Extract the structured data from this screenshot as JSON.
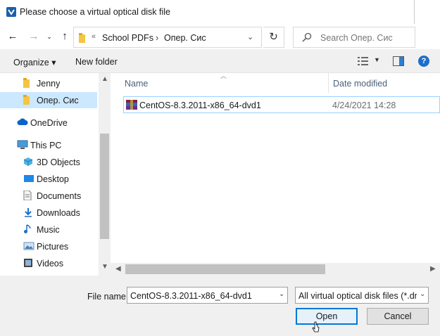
{
  "window": {
    "title": "Please choose a virtual optical disk file"
  },
  "nav": {
    "back_icon": "arrow-left-icon",
    "forward_icon": "arrow-right-icon",
    "recent_icon": "chevron-down-icon",
    "up_icon": "arrow-up-icon"
  },
  "address": {
    "overflow": "«",
    "crumbs": [
      "School PDFs",
      "Опер. Сис"
    ],
    "separator": "›"
  },
  "search": {
    "placeholder": "Search Опер. Сис"
  },
  "toolbar": {
    "organize": "Organize ▾",
    "new_folder": "New folder"
  },
  "sidebar": {
    "items": [
      {
        "label": "Jenny",
        "icon": "folder-icon",
        "selected": false
      },
      {
        "label": "Опер. Сис",
        "icon": "folder-icon",
        "selected": true
      },
      {
        "label": "OneDrive",
        "icon": "cloud-icon",
        "selected": false
      },
      {
        "label": "This PC",
        "icon": "computer-icon",
        "selected": false
      },
      {
        "label": "3D Objects",
        "icon": "cube-icon",
        "selected": false
      },
      {
        "label": "Desktop",
        "icon": "desktop-icon",
        "selected": false
      },
      {
        "label": "Documents",
        "icon": "document-icon",
        "selected": false
      },
      {
        "label": "Downloads",
        "icon": "download-icon",
        "selected": false
      },
      {
        "label": "Music",
        "icon": "music-icon",
        "selected": false
      },
      {
        "label": "Pictures",
        "icon": "picture-icon",
        "selected": false
      },
      {
        "label": "Videos",
        "icon": "video-icon",
        "selected": false
      }
    ]
  },
  "filelist": {
    "columns": {
      "name": "Name",
      "date": "Date modified"
    },
    "files": [
      {
        "name": "CentOS-8.3.2011-x86_64-dvd1",
        "date": "4/24/2021 14:28",
        "icon": "archive-icon"
      }
    ]
  },
  "footer": {
    "filename_label": "File name:",
    "filename_value": "CentOS-8.3.2011-x86_64-dvd1",
    "filetype_value": "All virtual optical disk files (*.dmg",
    "open": "Open",
    "cancel": "Cancel"
  },
  "colors": {
    "selected_bg": "#cce8ff",
    "accent": "#0078d7",
    "toolbar_bg": "#f0f0f0"
  }
}
